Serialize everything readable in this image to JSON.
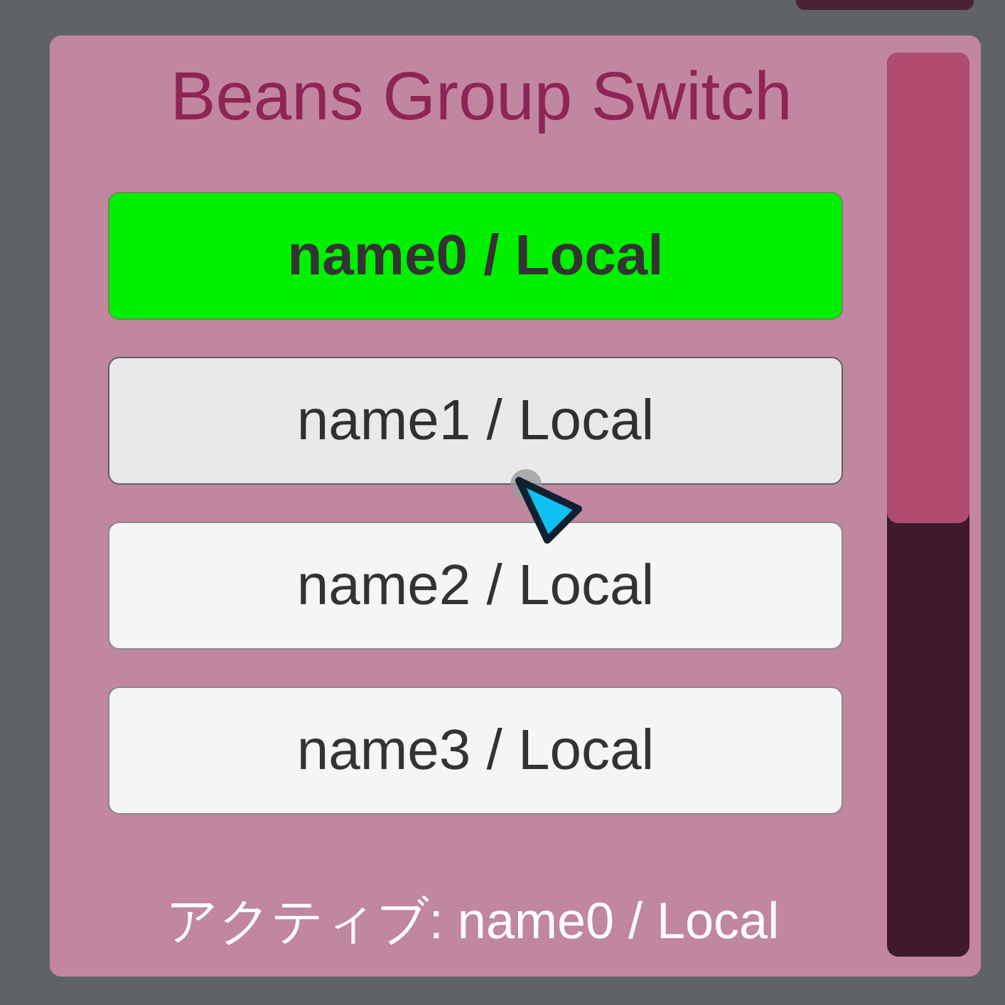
{
  "panel": {
    "title": "Beans Group Switch"
  },
  "buttons": [
    {
      "label": "name0 / Local",
      "selected": true,
      "hovered": false
    },
    {
      "label": "name1 / Local",
      "selected": false,
      "hovered": true
    },
    {
      "label": "name2 / Local",
      "selected": false,
      "hovered": false
    },
    {
      "label": "name3 / Local",
      "selected": false,
      "hovered": false
    }
  ],
  "status": "アクティブ: name0 / Local"
}
